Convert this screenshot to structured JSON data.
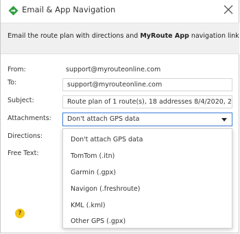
{
  "dialog": {
    "title": "Email & App Navigation",
    "close_icon": "close-icon",
    "title_icon": "navigation-diamond-icon",
    "accent_color": "#2e9e3e"
  },
  "intro": {
    "text_before": "Email the route plan with directions and ",
    "text_bold": "MyRoute App",
    "text_after": " navigation link"
  },
  "form": {
    "from_label": "From:",
    "from_value": "support@myrouteonline.com",
    "to_label": "To:",
    "to_value": "support@myrouteonline.com",
    "subject_label": "Subject:",
    "subject_value": "Route plan of 1 route(s), 18 addresses 8/4/2020, 2:",
    "attachments_label": "Attachments:",
    "attachments_selected": "Don't attach GPS data",
    "directions_label": "Directions:",
    "free_text_label": "Free Text:"
  },
  "attachments_options": [
    "Don't attach GPS data",
    "TomTom (.itn)",
    "Garmin (.gpx)",
    "Navigon (.freshroute)",
    "KML (.kml)",
    "Other GPS (.gpx)"
  ],
  "help": {
    "icon": "help-icon",
    "glyph": "?"
  }
}
